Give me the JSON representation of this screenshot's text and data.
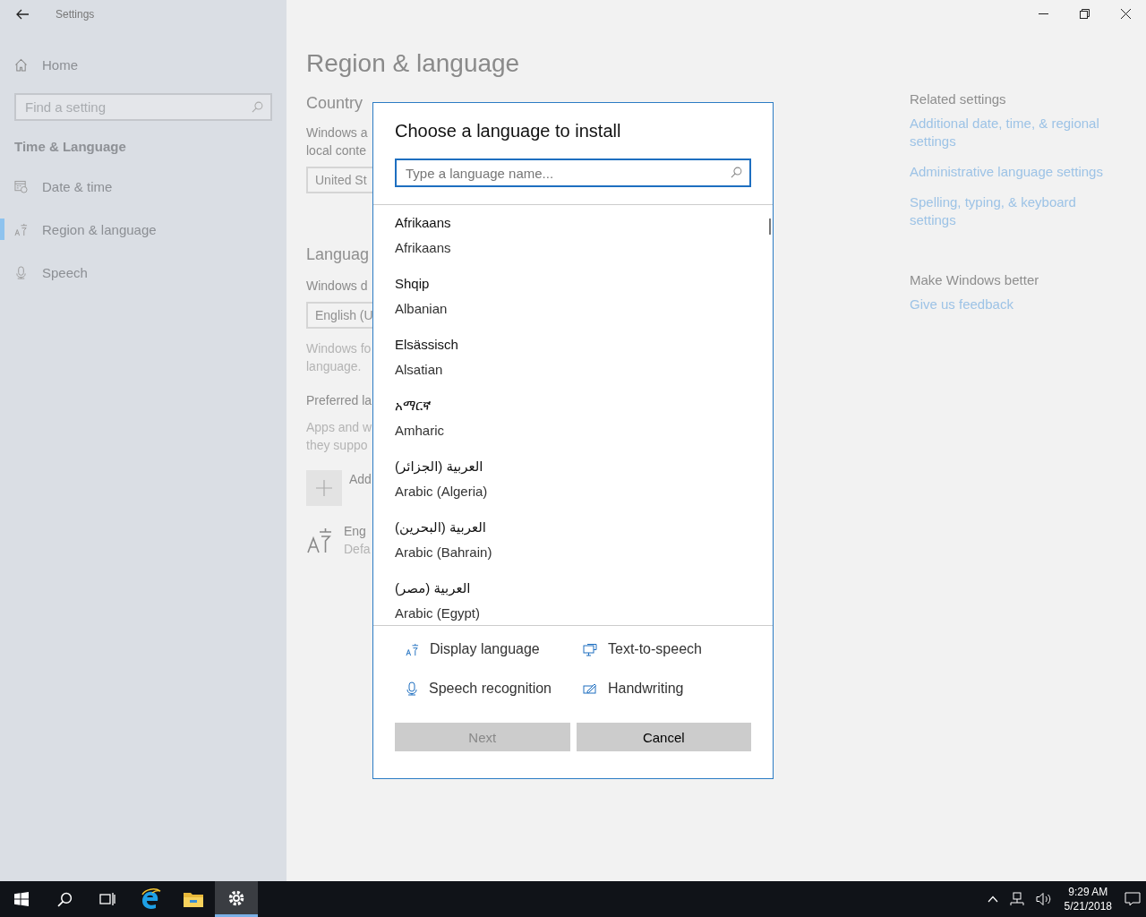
{
  "window": {
    "title": "Settings"
  },
  "sidebar": {
    "home": "Home",
    "search": {
      "placeholder": "Find a setting"
    },
    "section": "Time & Language",
    "items": [
      {
        "label": "Date & time",
        "selected": false
      },
      {
        "label": "Region & language",
        "selected": true
      },
      {
        "label": "Speech",
        "selected": false
      }
    ]
  },
  "page": {
    "title": "Region & language",
    "country": {
      "heading": "Country",
      "description": [
        "Windows a",
        "local conte"
      ],
      "field": "United St"
    },
    "language": {
      "heading": "Languag",
      "display_label": "Windows d",
      "display_field": "English (U",
      "display_note": [
        "Windows fo",
        "language."
      ],
      "preferred_heading": "Preferred la",
      "preferred_note": [
        "Apps and w",
        "they suppo"
      ],
      "add_button": "Add",
      "installed": {
        "name": "Eng",
        "status": "Defa"
      }
    }
  },
  "related": {
    "heading": "Related settings",
    "links": [
      "Additional date, time, & regional settings",
      "Administrative language settings",
      "Spelling, typing, & keyboard settings"
    ]
  },
  "feedback": {
    "heading": "Make Windows better",
    "link": "Give us feedback"
  },
  "dialog": {
    "title": "Choose a language to install",
    "search": {
      "placeholder": "Type a language name..."
    },
    "languages": [
      {
        "native": "Afrikaans",
        "english": "Afrikaans",
        "selected": false
      },
      {
        "native": "Shqip",
        "english": "Albanian",
        "selected": false
      },
      {
        "native": "Elsässisch",
        "english": "Alsatian",
        "selected": false
      },
      {
        "native": "አማርኛ",
        "english": "Amharic",
        "selected": false
      },
      {
        "native": "العربية (الجزائر)",
        "english": "Arabic (Algeria)",
        "selected": false
      },
      {
        "native": "العربية (البحرين)",
        "english": "Arabic (Bahrain)",
        "selected": false
      },
      {
        "native": "العربية (مصر)",
        "english": "Arabic (Egypt)",
        "selected": false
      }
    ],
    "features": [
      "Display language",
      "Text-to-speech",
      "Speech recognition",
      "Handwriting"
    ],
    "buttons": [
      {
        "label": "Next",
        "disabled": true
      },
      {
        "label": "Cancel",
        "disabled": false
      }
    ]
  },
  "taskbar": {
    "pinned": [
      {
        "active": false
      },
      {
        "active": false
      },
      {
        "active": true
      }
    ],
    "time": "9:29 AM",
    "date": "5/21/2018"
  }
}
